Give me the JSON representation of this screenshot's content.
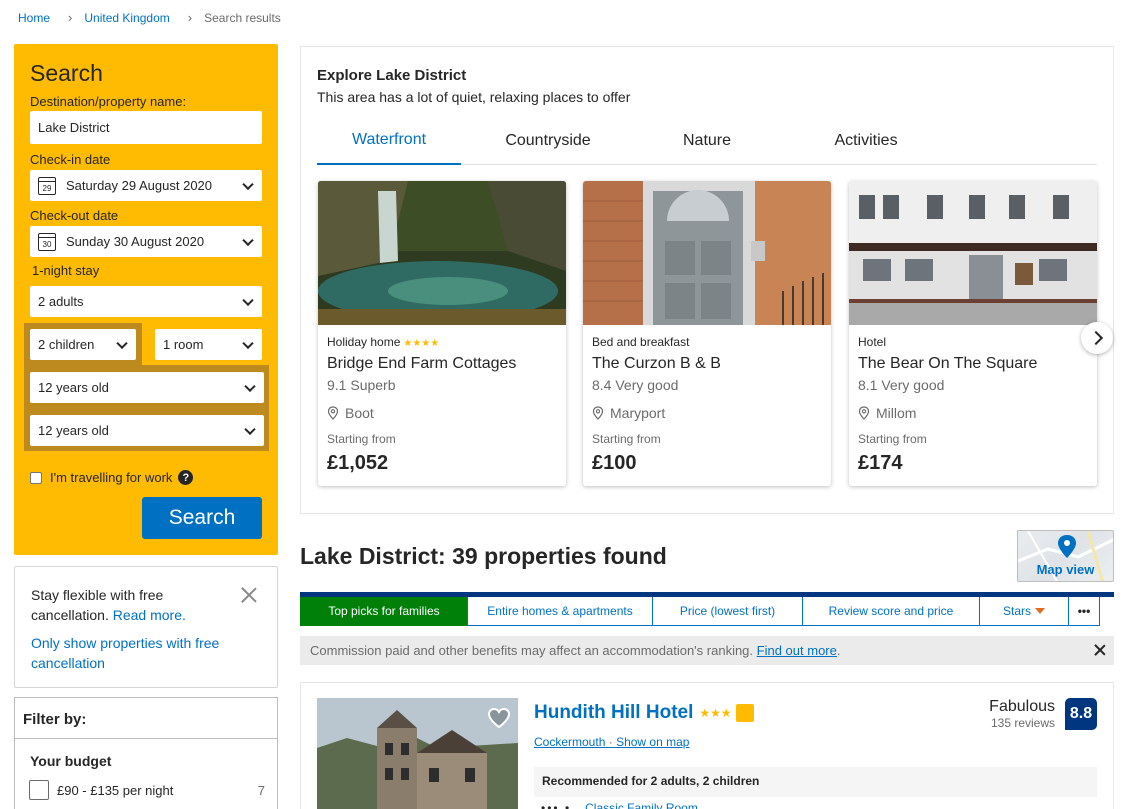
{
  "breadcrumb": [
    "Home",
    "United Kingdom",
    "Search results"
  ],
  "search": {
    "title": "Search",
    "destination_label": "Destination/property name:",
    "destination_value": "Lake District",
    "checkin_label": "Check-in date",
    "checkin_day": "29",
    "checkin_value": "Saturday 29 August 2020",
    "checkout_label": "Check-out date",
    "checkout_day": "30",
    "checkout_value": "Sunday 30 August 2020",
    "stay_length": "1-night stay",
    "adults": "2 adults",
    "children": "2 children",
    "rooms": "1 room",
    "child_ages": [
      "12 years old",
      "12 years old"
    ],
    "work_label": "I'm travelling for work",
    "work_help": "?",
    "button": "Search"
  },
  "flexible": {
    "text": "Stay flexible with free cancellation.",
    "read_more": "Read more.",
    "only_free": "Only show properties with free cancellation"
  },
  "filter": {
    "title": "Filter by:",
    "budget_title": "Your budget",
    "budget_option": "£90 - £135 per night",
    "budget_count": "7"
  },
  "explore": {
    "title": "Explore Lake District",
    "subtitle": "This area has a lot of quiet, relaxing places to offer",
    "tabs": [
      "Waterfront",
      "Countryside",
      "Nature",
      "Activities"
    ],
    "active_tab": "Waterfront",
    "cards": [
      {
        "type": "Holiday home",
        "stars": "★★★★",
        "name": "Bridge End Farm Cottages",
        "score": "9.1 Superb",
        "location": "Boot",
        "starting": "Starting from",
        "price": "£1,052"
      },
      {
        "type": "Bed and breakfast",
        "stars": "",
        "name": "The Curzon B & B",
        "score": "8.4 Very good",
        "location": "Maryport",
        "starting": "Starting from",
        "price": "£100"
      },
      {
        "type": "Hotel",
        "stars": "",
        "name": "The Bear On The Square",
        "score": "8.1 Very good",
        "location": "Millom",
        "starting": "Starting from",
        "price": "£174"
      }
    ]
  },
  "results": {
    "title": "Lake District: 39 properties found",
    "map_view": "Map view",
    "sort_tabs": [
      "Top picks for families",
      "Entire homes & apartments",
      "Price (lowest first)",
      "Review score and price",
      "Stars"
    ],
    "more": "•••",
    "commission_text": "Commission paid and other benefits may affect an accommodation's ranking.",
    "commission_link": "Find out more",
    "commission_end": "."
  },
  "hotel": {
    "name": "Hundith Hill Hotel",
    "stars": "★★★",
    "town": "Cockermouth",
    "sep": "·",
    "show_map": "Show on map",
    "review_word": "Fabulous",
    "reviews": "135 reviews",
    "score": "8.8",
    "recommended": "Recommended for 2 adults, 2 children",
    "room": "Classic Family Room"
  },
  "colors": {
    "brand_blue": "#0071c2",
    "dark_blue": "#003580",
    "yellow": "#febb02",
    "green": "#008009"
  }
}
